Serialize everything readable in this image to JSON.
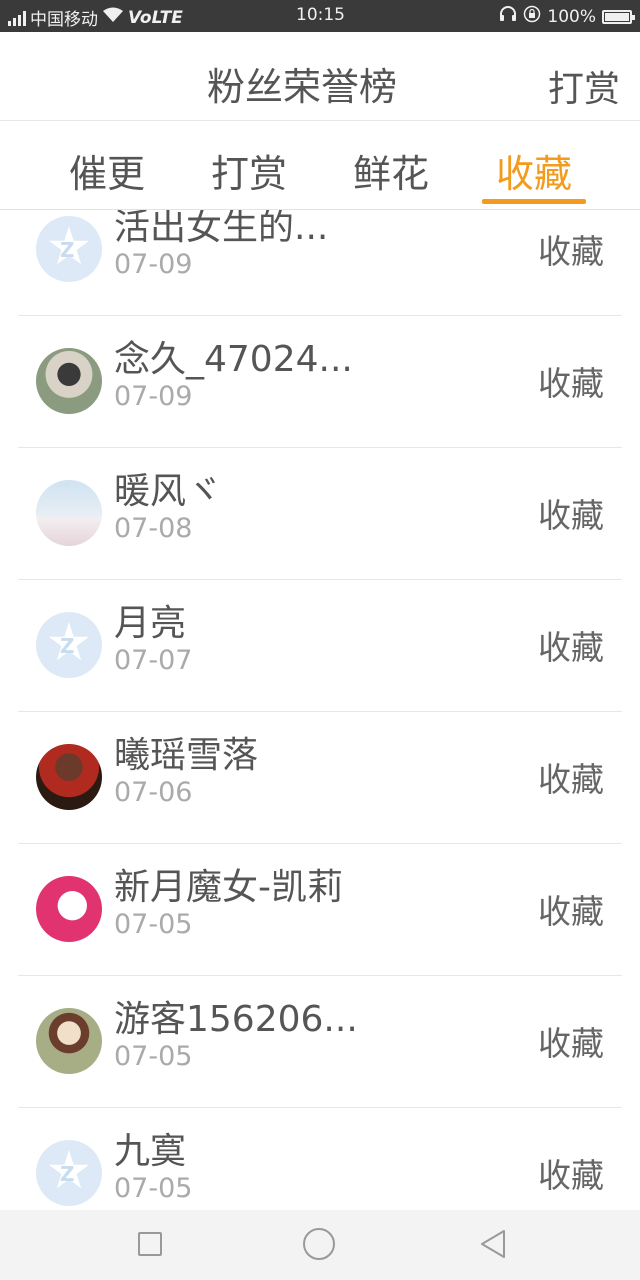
{
  "statusbar": {
    "carrier": "中国移动",
    "network": "VoLTE",
    "time": "10:15",
    "battery": "100%"
  },
  "header": {
    "title": "粉丝荣誉榜",
    "action": "打赏"
  },
  "tabs": [
    {
      "label": "催更"
    },
    {
      "label": "打赏"
    },
    {
      "label": "鲜花"
    },
    {
      "label": "收藏",
      "active": true
    }
  ],
  "items": [
    {
      "name": "活出女生的...",
      "date": "07-09",
      "tag": "收藏",
      "avatar": "default"
    },
    {
      "name": "念久_47024...",
      "date": "07-09",
      "tag": "收藏",
      "avatar": "photo"
    },
    {
      "name": "暖风ヾ",
      "date": "07-08",
      "tag": "收藏",
      "avatar": "photo"
    },
    {
      "name": "月亮",
      "date": "07-07",
      "tag": "收藏",
      "avatar": "default"
    },
    {
      "name": "曦瑶雪落",
      "date": "07-06",
      "tag": "收藏",
      "avatar": "photo"
    },
    {
      "name": "新月魔女-凯莉",
      "date": "07-05",
      "tag": "收藏",
      "avatar": "photo"
    },
    {
      "name": "游客156206...",
      "date": "07-05",
      "tag": "收藏",
      "avatar": "photo"
    },
    {
      "name": "九寞",
      "date": "07-05",
      "tag": "收藏",
      "avatar": "default"
    }
  ],
  "colors": {
    "accent": "#f29b1d",
    "text": "#555555",
    "subtext": "#aaaaaa",
    "statusbar_bg": "#3a3a3a"
  },
  "icons": [
    "signal-icon",
    "wifi-icon",
    "headphones-icon",
    "lock-rotation-icon",
    "battery-icon",
    "nav-square-icon",
    "nav-home-icon",
    "nav-back-icon"
  ]
}
